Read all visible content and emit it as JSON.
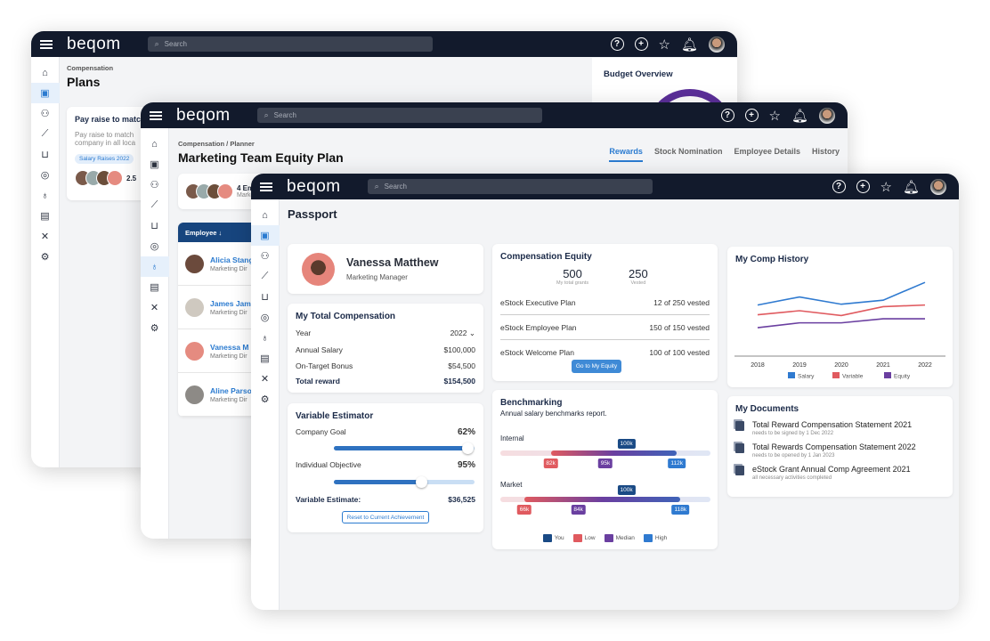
{
  "brand": {
    "logo": "beqom",
    "search_placeholder": "Search"
  },
  "header_icons": [
    "help-icon",
    "add-icon",
    "star-icon",
    "bell-icon",
    "avatar"
  ],
  "sidebar_icons": [
    "home-icon",
    "plans-icon",
    "team-icon",
    "analytics-icon",
    "inbox-icon",
    "target-icon",
    "money-bag-icon",
    "certificate-icon",
    "tools-icon",
    "gear-icon"
  ],
  "window1": {
    "breadcrumb": "Compensation",
    "title": "Plans",
    "card": {
      "title": "Pay raise to matc",
      "desc1": "Pay raise to match",
      "desc2": "company in all loca",
      "tag": "Salary Raises 2022",
      "count": "2.5"
    },
    "budget_title": "Budget Overview"
  },
  "window2": {
    "breadcrumb": "Compensation / Planner",
    "title": "Marketing Team Equity Plan",
    "tabs": [
      {
        "label": "Rewards",
        "active": true
      },
      {
        "label": "Stock Nomination"
      },
      {
        "label": "Employee Details"
      },
      {
        "label": "History"
      }
    ],
    "summary": {
      "count": "4 Em",
      "sub": "Marke"
    },
    "table_header": "Employee ↓",
    "employees": [
      {
        "name": "Alicia Stang",
        "role": "Marketing Dir"
      },
      {
        "name": "James Jam",
        "role": "Marketing Dir"
      },
      {
        "name": "Vanessa M",
        "role": "Marketing Dir"
      },
      {
        "name": "Aline Parso",
        "role": "Marketing Dir"
      }
    ]
  },
  "passport": {
    "title": "Passport",
    "profile": {
      "name": "Vanessa Matthew",
      "role": "Marketing Manager"
    },
    "total_comp": {
      "title": "My Total Compensation",
      "year_label": "Year",
      "year_value": "2022",
      "rows": [
        {
          "label": "Annual Salary",
          "value": "$100,000"
        },
        {
          "label": "On-Target Bonus",
          "value": "$54,500"
        }
      ],
      "total_label": "Total reward",
      "total_value": "$154,500"
    },
    "estimator": {
      "title": "Variable Estimator",
      "goals": [
        {
          "label": "Company Goal",
          "value": "62%",
          "slider_fraction": 0.95
        },
        {
          "label": "Individual Objective",
          "value": "95%",
          "slider_fraction": 0.62
        }
      ],
      "estimate_label": "Variable Estimate:",
      "estimate_value": "$36,525",
      "reset_label": "Reset to Current Achievement"
    },
    "equity": {
      "title": "Compensation Equity",
      "total": "500",
      "total_label": "My total grants",
      "vested": "250",
      "vested_label": "Vested",
      "plans": [
        {
          "name": "eStock Executive Plan",
          "status": "12 of 250 vested"
        },
        {
          "name": "eStock Employee Plan",
          "status": "150 of 150 vested"
        },
        {
          "name": "eStock Welcome Plan",
          "status": "100 of 100 vested"
        }
      ],
      "button": "Go to My Equity"
    },
    "benchmark": {
      "title": "Benchmarking",
      "subtitle": "Annual salary benchmarks report.",
      "rows": [
        {
          "label": "Internal",
          "low": "82k",
          "median": "95k",
          "high": "112k",
          "you": "100k",
          "low_v": 82,
          "median_v": 95,
          "high_v": 112,
          "you_v": 100
        },
        {
          "label": "Market",
          "low": "66k",
          "median": "84k",
          "high": "118k",
          "you": "100k",
          "low_v": 66,
          "median_v": 84,
          "high_v": 118,
          "you_v": 100
        }
      ],
      "legend": [
        {
          "label": "You",
          "color": "#1a4a85"
        },
        {
          "label": "Low",
          "color": "#e05a5f"
        },
        {
          "label": "Median",
          "color": "#6a3fa0"
        },
        {
          "label": "High",
          "color": "#2f7ad0"
        }
      ]
    },
    "documents": {
      "title": "My Documents",
      "items": [
        {
          "name": "Total Reward Compensation Statement 2021",
          "sub": "needs to be signed by 1 Dec 2022"
        },
        {
          "name": "Total Rewards Compensation Statement 2022",
          "sub": "needs to be opened by 1 Jan 2023"
        },
        {
          "name": "eStock Grant Annual Comp Agreement 2021",
          "sub": "all necessary activities completed"
        }
      ]
    }
  },
  "chart_data": {
    "type": "line",
    "title": "My Comp History",
    "categories": [
      "2018",
      "2019",
      "2020",
      "2021",
      "2022"
    ],
    "series": [
      {
        "name": "Salary",
        "color": "#2f7ad0",
        "values": [
          62,
          72,
          63,
          68,
          90
        ]
      },
      {
        "name": "Variable",
        "color": "#e05a5f",
        "values": [
          50,
          55,
          49,
          60,
          62
        ]
      },
      {
        "name": "Equity",
        "color": "#6a3fa0",
        "values": [
          34,
          40,
          40,
          45,
          45
        ]
      }
    ],
    "ylim": [
      0,
      110
    ],
    "grid": false,
    "legend": "bottom"
  }
}
